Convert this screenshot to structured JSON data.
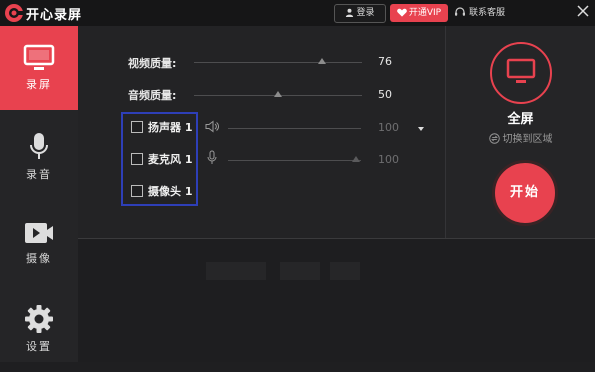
{
  "app": {
    "title": "开心录屏",
    "brand_color": "#e8424f"
  },
  "titlebar": {
    "login_label": "登录",
    "vip_label": "开通VIP",
    "service_label": "联系客服",
    "icons": [
      "logo-icon",
      "user-icon",
      "heart-icon",
      "headset-icon",
      "close-icon"
    ]
  },
  "sidebar": {
    "items": [
      {
        "label": "录屏",
        "icon": "monitor-icon",
        "active": true
      },
      {
        "label": "录音",
        "icon": "microphone-icon",
        "active": false
      },
      {
        "label": "摄像",
        "icon": "camera-icon",
        "active": false
      },
      {
        "label": "设置",
        "icon": "gear-icon",
        "active": false
      }
    ]
  },
  "settings": {
    "video_quality": {
      "label": "视频质量:",
      "value": "76",
      "level": 0.76
    },
    "audio_quality": {
      "label": "音频质量:",
      "value": "50",
      "level": 0.5
    },
    "speaker": {
      "label": "扬声器 1",
      "value": "100",
      "checked": false
    },
    "microphone": {
      "label": "麦克风 1",
      "value": "100",
      "checked": false
    },
    "camera": {
      "label": "摄像头 1",
      "checked": false
    }
  },
  "right_panel": {
    "mode_label": "全屏",
    "switch_label": "切换到区域",
    "start_label": "开始"
  }
}
